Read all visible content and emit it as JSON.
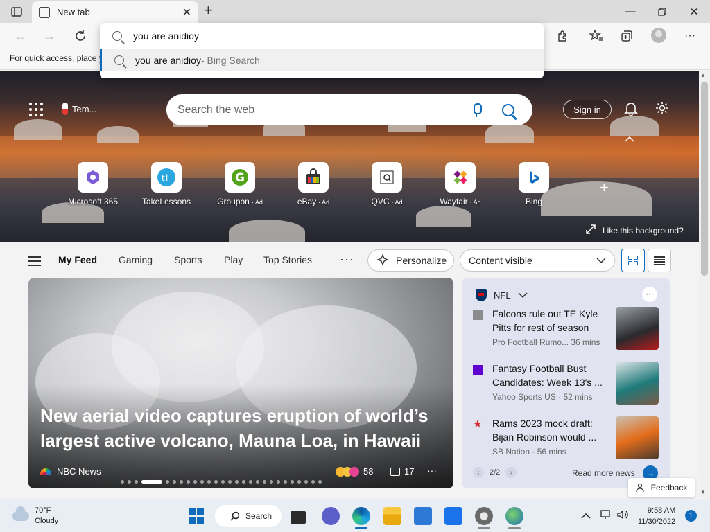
{
  "browser": {
    "tab_title": "New tab",
    "favorites_hint": "For quick access, place y"
  },
  "omnibox": {
    "typed": "you are anidioy",
    "suggestion_query": "you are anidioy",
    "suggestion_source": " - Bing Search"
  },
  "hero": {
    "weather_short": "Tem...",
    "search_placeholder": "Search the web",
    "signin_label": "Sign in",
    "like_background": "Like this background?",
    "quick_links": [
      {
        "label": "Microsoft 365",
        "ad": ""
      },
      {
        "label": "TakeLessons",
        "ad": ""
      },
      {
        "label": "Groupon",
        "ad": "· Ad"
      },
      {
        "label": "eBay",
        "ad": "· Ad"
      },
      {
        "label": "QVC",
        "ad": "· Ad"
      },
      {
        "label": "Wayfair",
        "ad": "· Ad"
      },
      {
        "label": "Bing",
        "ad": ""
      }
    ]
  },
  "feed_nav": {
    "tabs": [
      "My Feed",
      "Gaming",
      "Sports",
      "Play",
      "Top Stories"
    ],
    "personalize": "Personalize",
    "content_visible": "Content visible"
  },
  "main_story": {
    "headline": "New aerial video captures eruption of world’s largest active volcano, Mauna Loa, in Hawaii",
    "source": "NBC News",
    "reactions": "58",
    "comments": "17"
  },
  "nfl": {
    "league": "NFL",
    "stories": [
      {
        "title": "Falcons rule out TE Kyle Pitts for rest of season",
        "meta": "Pro Football Rumo... 36 mins"
      },
      {
        "title": "Fantasy Football Bust Candidates: Week 13's ...",
        "meta": "Yahoo Sports US · 52 mins"
      },
      {
        "title": "Rams 2023 mock draft: Bijan Robinson would ...",
        "meta": "SB Nation · 56 mins"
      }
    ],
    "pager": "2/2",
    "read_more": "Read more news"
  },
  "feedback": "Feedback",
  "taskbar": {
    "temp": "70°F",
    "condition": "Cloudy",
    "search": "Search",
    "time": "9:58 AM",
    "date": "11/30/2022",
    "notifications": "1"
  },
  "colors": {
    "accent": "#0f6cbd",
    "nfl_panel": "#e2e3f1"
  }
}
